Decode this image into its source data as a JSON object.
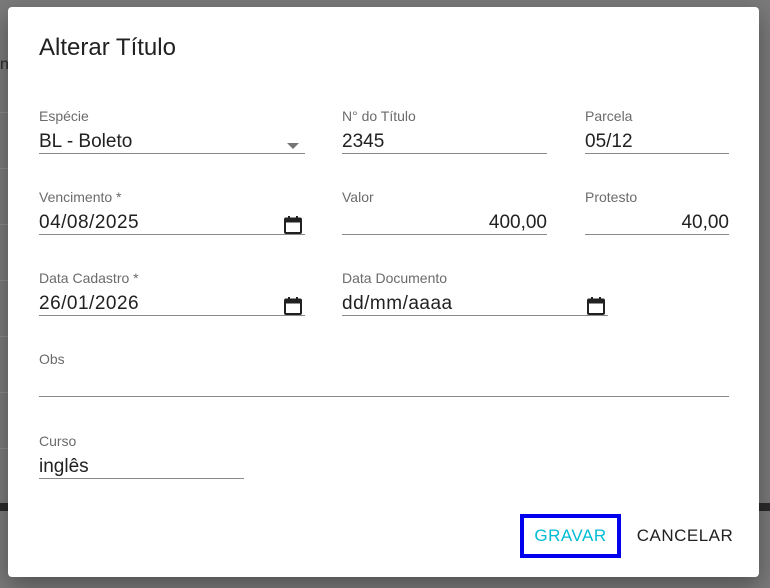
{
  "background": {
    "partial_text": "n"
  },
  "dialog": {
    "title": "Alterar Título",
    "fields": {
      "especie": {
        "label": "Espécie",
        "value": "BL - Boleto"
      },
      "numero_titulo": {
        "label": "N° do Título",
        "value": "2345"
      },
      "parcela": {
        "label": "Parcela",
        "value": "05/12"
      },
      "vencimento": {
        "label": "Vencimento *",
        "value": "04/08/2025"
      },
      "valor": {
        "label": "Valor",
        "value": "400,00"
      },
      "protesto": {
        "label": "Protesto",
        "value": "40,00"
      },
      "data_cadastro": {
        "label": "Data Cadastro *",
        "value": "26/01/2026"
      },
      "data_documento": {
        "label": "Data Documento",
        "value": "dd/mm/aaaa"
      },
      "obs": {
        "label": "Obs",
        "value": ""
      },
      "curso": {
        "label": "Curso",
        "value": "inglês"
      }
    },
    "actions": {
      "save_label": "GRAVAR",
      "cancel_label": "CANCELAR"
    }
  },
  "colors": {
    "primary_button_text": "#00bcd4",
    "focus_outline": "#0000ee",
    "text": "#212121",
    "label": "#6b6b6b",
    "overlay": "#7a7a7a"
  },
  "icons": {
    "dropdown": "arrow-drop-down-icon",
    "calendar": "calendar-icon"
  }
}
